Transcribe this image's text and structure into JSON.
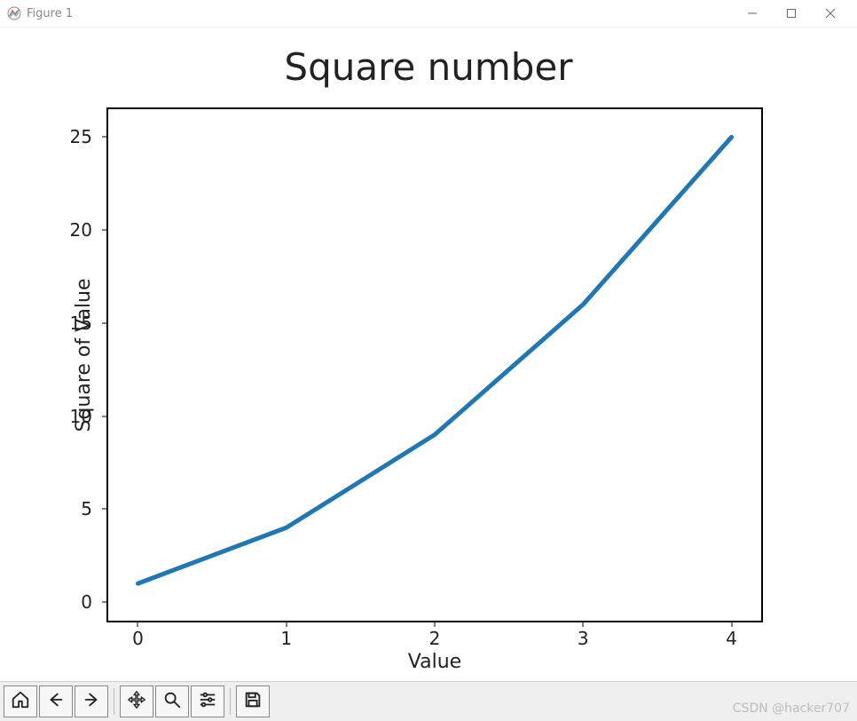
{
  "window": {
    "title": "Figure 1"
  },
  "chart_data": {
    "type": "line",
    "x": [
      0,
      1,
      2,
      3,
      4
    ],
    "y": [
      1,
      4,
      9,
      16,
      25
    ],
    "title": "Square number",
    "xlabel": "Value",
    "ylabel": "Square of Value",
    "xticks": [
      0,
      1,
      2,
      3,
      4
    ],
    "yticks": [
      0,
      5,
      10,
      15,
      20,
      25
    ],
    "xlim": [
      -0.2,
      4.2
    ],
    "ylim": [
      -1.0,
      26.5
    ],
    "line_color": "#1f77b4",
    "line_width": 5
  },
  "toolbar": {
    "home": "Home",
    "back": "Back",
    "forward": "Forward",
    "pan": "Pan",
    "zoom": "Zoom",
    "configure": "Configure subplots",
    "save": "Save"
  },
  "watermark": "CSDN @hacker707"
}
